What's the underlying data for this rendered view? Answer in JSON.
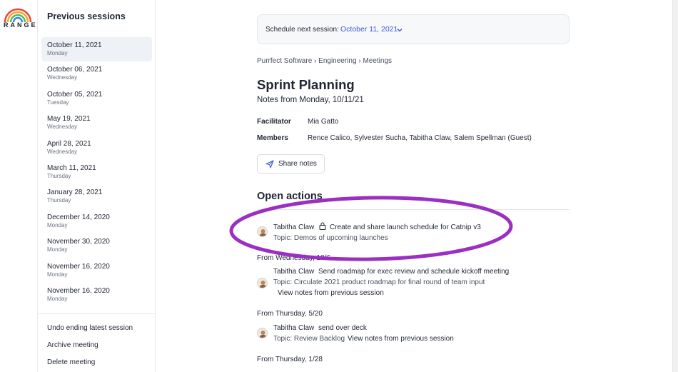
{
  "brand": {
    "logo_text": "RANGE"
  },
  "sidebar": {
    "title": "Previous sessions",
    "sessions": [
      {
        "date": "October 11, 2021",
        "day": "Monday"
      },
      {
        "date": "October 06, 2021",
        "day": "Wednesday"
      },
      {
        "date": "October 05, 2021",
        "day": "Tuesday"
      },
      {
        "date": "May 19, 2021",
        "day": "Wednesday"
      },
      {
        "date": "April 28, 2021",
        "day": "Wednesday"
      },
      {
        "date": "March 11, 2021",
        "day": "Thursday"
      },
      {
        "date": "January 28, 2021",
        "day": "Thursday"
      },
      {
        "date": "December 14, 2020",
        "day": "Monday"
      },
      {
        "date": "November 30, 2020",
        "day": "Monday"
      },
      {
        "date": "November 16, 2020",
        "day": "Monday"
      },
      {
        "date": "November 16, 2020",
        "day": "Monday"
      }
    ],
    "menu": {
      "undo": "Undo ending latest session",
      "archive": "Archive meeting",
      "delete": "Delete meeting"
    }
  },
  "schedule": {
    "label": "Schedule next session:",
    "value": "October 11, 2021"
  },
  "breadcrumb": {
    "org": "Purrfect Software",
    "team": "Engineering",
    "section": "Meetings",
    "sep": "›"
  },
  "page": {
    "title": "Sprint Planning",
    "subtitle": "Notes from Monday, 10/11/21"
  },
  "fields": {
    "facilitator_label": "Facilitator",
    "facilitator_value": "Mia Gatto",
    "members_label": "Members",
    "members_value": "Rence Calico, Sylvester Sucha, Tabitha Claw, Salem Spellman (Guest)"
  },
  "share_button": {
    "label": "Share notes"
  },
  "open_actions": {
    "title": "Open actions",
    "items": [
      {
        "owner": "Tabitha Claw",
        "text": "Create and share launch schedule for Catnip v3",
        "topic": "Topic: Demos of upcoming launches"
      },
      {
        "from": "From Wednesday, 10/6",
        "owner": "Tabitha Claw",
        "text": "Send roadmap for exec review and schedule kickoff meeting",
        "topic": "Topic: Circulate 2021 product roadmap for final round of team input",
        "view_link": "View notes from previous session"
      },
      {
        "from": "From Thursday, 5/20",
        "owner": "Tabitha Claw",
        "text": "send over deck",
        "topic": "Topic: Review Backlog",
        "view_link": "View notes from previous session"
      },
      {
        "from": "From Thursday, 1/28"
      }
    ]
  },
  "colors": {
    "accent": "#3b5bdb",
    "highlight": "#9b2fc2"
  }
}
